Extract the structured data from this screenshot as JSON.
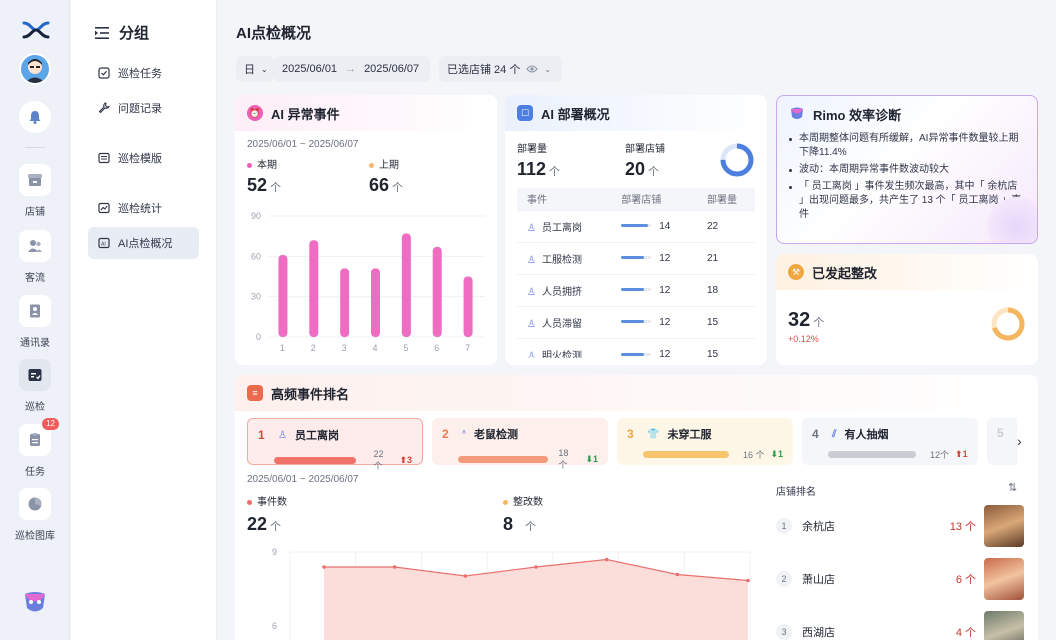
{
  "rail": {
    "items": [
      {
        "label": "店铺",
        "icon": "store-icon"
      },
      {
        "label": "客流",
        "icon": "customers-icon"
      },
      {
        "label": "通讯录",
        "icon": "contacts-icon"
      },
      {
        "label": "巡检",
        "icon": "inspection-icon"
      },
      {
        "label": "任务",
        "icon": "tasks-icon",
        "badge": "12"
      },
      {
        "label": "巡检图库",
        "icon": "gallery-icon"
      }
    ]
  },
  "subnav": {
    "title": "分组",
    "items": [
      {
        "label": "巡检任务"
      },
      {
        "label": "问题记录"
      },
      {
        "label": "巡检模版"
      },
      {
        "label": "巡检统计"
      },
      {
        "label": "AI点检概况"
      }
    ]
  },
  "page": {
    "title": "AI点检概况"
  },
  "filters": {
    "period": "日",
    "date_start": "2025/06/01",
    "arrow": "→",
    "date_end": "2025/06/07",
    "stores": "已选店铺 24 个"
  },
  "anomaly": {
    "title": "AI 异常事件",
    "range": "2025/06/01 ~ 2025/06/07",
    "current_label": "本期",
    "current_value": "52",
    "previous_label": "上期",
    "previous_value": "66",
    "unit": "个"
  },
  "deploy": {
    "title": "AI 部署概况",
    "count_label": "部署量",
    "count_value": "112",
    "stores_label": "部署店铺",
    "stores_value": "20",
    "unit": "个",
    "columns": [
      "事件",
      "部署店铺",
      "部署量"
    ],
    "rows": [
      {
        "event": "员工离岗",
        "stores": "14",
        "count": "22",
        "fill": 0.88
      },
      {
        "event": "工服检测",
        "stores": "12",
        "count": "21",
        "fill": 0.75
      },
      {
        "event": "人员拥挤",
        "stores": "12",
        "count": "18",
        "fill": 0.75
      },
      {
        "event": "人员滞留",
        "stores": "12",
        "count": "15",
        "fill": 0.75
      },
      {
        "event": "明火检测",
        "stores": "12",
        "count": "15",
        "fill": 0.75
      }
    ]
  },
  "rimo": {
    "title": "Rimo 效率诊断",
    "points": [
      "本周期整体问题有所缓解，AI异常事件数量较上期下降11.4%",
      "波动：本周期异常事件数波动较大",
      "「 员工离岗 」事件发生频次最高，其中「 余杭店 」出现问题最多，共产生了 13 个「 员工离岗 」事件"
    ]
  },
  "rectify": {
    "title": "已发起整改",
    "value": "32",
    "unit": "个",
    "change": "+0.12%"
  },
  "ranking": {
    "title": "高频事件排名",
    "items": [
      {
        "rank": "1",
        "name": "员工离岗",
        "count": "22 个",
        "delta": "3",
        "dir": "up"
      },
      {
        "rank": "2",
        "name": "老鼠检测",
        "count": "18 个",
        "delta": "1",
        "dir": "down"
      },
      {
        "rank": "3",
        "name": "未穿工服",
        "count": "16 个",
        "delta": "1",
        "dir": "down"
      },
      {
        "rank": "4",
        "name": "有人抽烟",
        "count": "12个",
        "delta": "1",
        "dir": "up"
      },
      {
        "rank": "5"
      }
    ],
    "range": "2025/06/01 ~ 2025/06/07",
    "events_label": "事件数",
    "events_value": "22",
    "rectify_label": "整改数",
    "rectify_value": "8",
    "unit": "个",
    "store_rank_title": "店铺排名",
    "stores": [
      {
        "rank": "1",
        "name": "余杭店",
        "count": "13 个"
      },
      {
        "rank": "2",
        "name": "萧山店",
        "count": "6 个"
      },
      {
        "rank": "3",
        "name": "西湖店",
        "count": "4 个"
      }
    ]
  },
  "chart_data": [
    {
      "type": "bar",
      "categories": [
        "1",
        "2",
        "3",
        "4",
        "5",
        "6",
        "7"
      ],
      "values": [
        61,
        72,
        51,
        51,
        77,
        67,
        45
      ],
      "ylim": [
        0,
        90
      ],
      "yticks": [
        "0",
        "30",
        "60",
        "90"
      ],
      "color": "#ee6cc1"
    },
    {
      "type": "area",
      "values": [
        8,
        8,
        7.4,
        8,
        8.5,
        7.5,
        7.1
      ],
      "ylim": [
        5,
        9
      ],
      "yticks": [
        "9",
        "6"
      ],
      "color": "#e8716f"
    }
  ]
}
